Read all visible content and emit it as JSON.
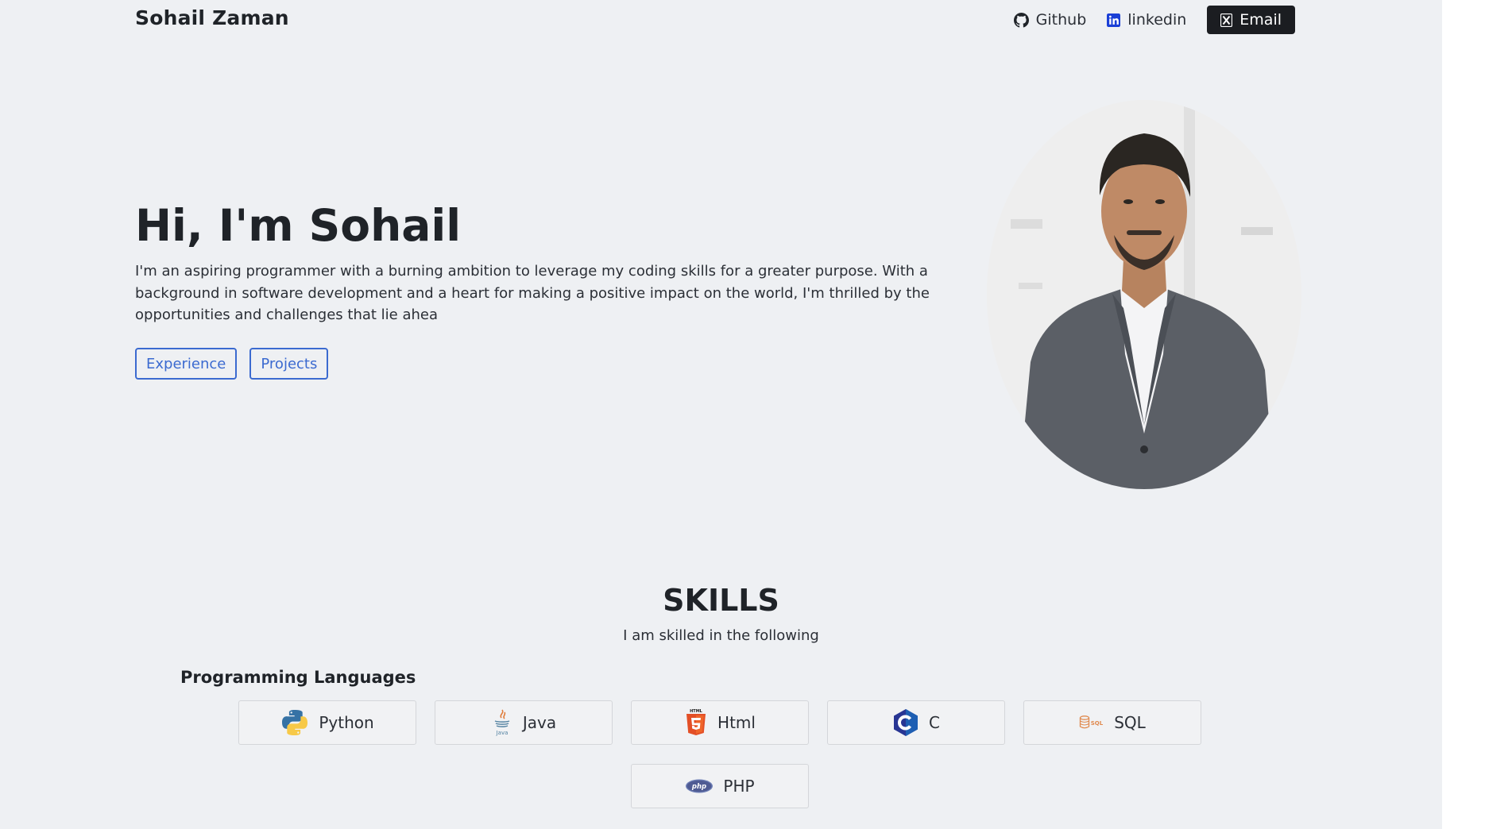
{
  "header": {
    "brand": "Sohail Zaman",
    "nav": {
      "github": "Github",
      "linkedin": "linkedin",
      "email": "Email"
    }
  },
  "hero": {
    "title": "Hi, I'm Sohail",
    "text": "I'm an aspiring programmer with a burning ambition to leverage my coding skills for a greater purpose. With a background in software development and a heart for making a positive impact on the world, I'm thrilled by the opportunities and challenges that lie ahea",
    "buttons": {
      "experience": "Experience",
      "projects": "Projects"
    }
  },
  "skills": {
    "title": "SKILLS",
    "subtitle": "I am skilled in the following",
    "category": "Programming Languages",
    "items": [
      {
        "label": "Python",
        "icon": "python-icon"
      },
      {
        "label": "Java",
        "icon": "java-icon"
      },
      {
        "label": "Html",
        "icon": "html5-icon"
      },
      {
        "label": "C",
        "icon": "c-language-icon"
      },
      {
        "label": "SQL",
        "icon": "sql-icon"
      },
      {
        "label": "PHP",
        "icon": "php-icon"
      }
    ]
  },
  "colors": {
    "background": "#eef0f3",
    "accent": "#3b6ad0",
    "email_button": "#1b1d21"
  }
}
